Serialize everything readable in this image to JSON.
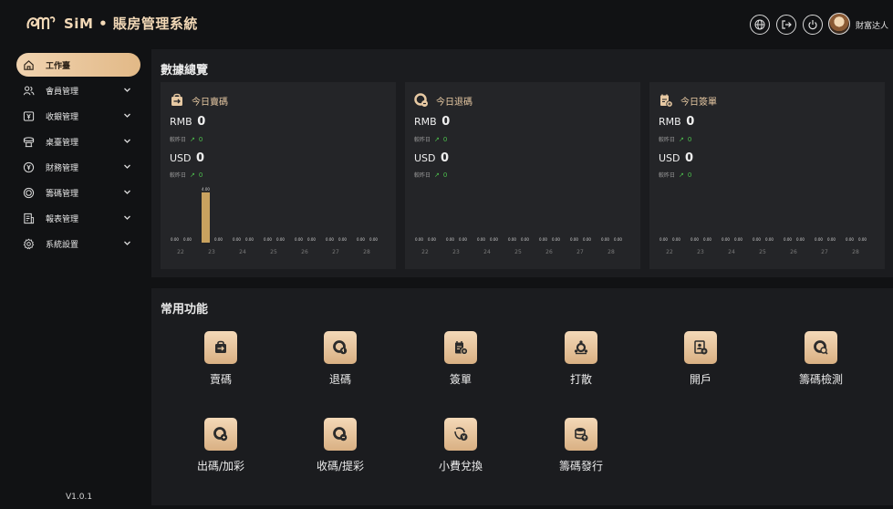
{
  "header": {
    "logo_text": "SiM • 賬房管理系統",
    "username": "財富达人",
    "buttons": [
      "globe-icon",
      "logout-icon",
      "power-icon"
    ]
  },
  "sidebar": {
    "items": [
      {
        "label": "工作臺",
        "icon": "home-icon",
        "active": true
      },
      {
        "label": "會員管理",
        "icon": "users-icon"
      },
      {
        "label": "收銀管理",
        "icon": "cashier-icon"
      },
      {
        "label": "桌臺管理",
        "icon": "table-icon"
      },
      {
        "label": "財務管理",
        "icon": "finance-icon"
      },
      {
        "label": "籌碼管理",
        "icon": "chip-icon"
      },
      {
        "label": "報表管理",
        "icon": "report-icon"
      },
      {
        "label": "系統設置",
        "icon": "settings-icon"
      }
    ],
    "version": "V1.0.1"
  },
  "overview": {
    "title": "數據總覽",
    "compare_label": "較昨日",
    "cards": [
      {
        "title": "今日賣碼",
        "icon": "sell-chip-icon",
        "rmb_label": "RMB",
        "rmb_value": "0",
        "rmb_change": "0",
        "usd_label": "USD",
        "usd_value": "0",
        "usd_change": "0"
      },
      {
        "title": "今日退碼",
        "icon": "return-chip-icon",
        "rmb_label": "RMB",
        "rmb_value": "0",
        "rmb_change": "0",
        "usd_label": "USD",
        "usd_value": "0",
        "usd_change": "0"
      },
      {
        "title": "今日簽單",
        "icon": "sign-bill-icon",
        "rmb_label": "RMB",
        "rmb_value": "0",
        "rmb_change": "0",
        "usd_label": "USD",
        "usd_value": "0",
        "usd_change": "0"
      }
    ]
  },
  "chart_data": [
    {
      "type": "bar",
      "categories": [
        "22",
        "23",
        "24",
        "25",
        "26",
        "27",
        "28"
      ],
      "series": [
        {
          "values": [
            0,
            4.0,
            0,
            0,
            0,
            0,
            0
          ],
          "color": "#c9a25f"
        },
        {
          "values": [
            0,
            0,
            0,
            0,
            0,
            0,
            0
          ],
          "color": "#c9a25f"
        }
      ],
      "ylim": [
        0,
        4.5
      ]
    },
    {
      "type": "bar",
      "categories": [
        "22",
        "23",
        "24",
        "25",
        "26",
        "27",
        "28"
      ],
      "series": [
        {
          "values": [
            0,
            0,
            0,
            0,
            0,
            0,
            0
          ]
        },
        {
          "values": [
            0,
            0,
            0,
            0,
            0,
            0,
            0
          ]
        }
      ]
    },
    {
      "type": "bar",
      "categories": [
        "22",
        "23",
        "24",
        "25",
        "26",
        "27",
        "28"
      ],
      "series": [
        {
          "values": [
            0,
            0,
            0,
            0,
            0,
            0,
            0
          ]
        },
        {
          "values": [
            0,
            0,
            0,
            0,
            0,
            0,
            0
          ]
        }
      ]
    }
  ],
  "functions": {
    "title": "常用功能",
    "items": [
      {
        "label": "賣碼",
        "icon": "sell-icon"
      },
      {
        "label": "退碼",
        "icon": "return-icon"
      },
      {
        "label": "簽單",
        "icon": "sign-icon"
      },
      {
        "label": "打散",
        "icon": "scatter-icon"
      },
      {
        "label": "開戶",
        "icon": "open-account-icon"
      },
      {
        "label": "籌碼檢測",
        "icon": "chip-check-icon"
      },
      {
        "label": "出碼/加彩",
        "icon": "issue-chip-icon"
      },
      {
        "label": "收碼/提彩",
        "icon": "collect-chip-icon"
      },
      {
        "label": "小費兌換",
        "icon": "tip-exchange-icon"
      },
      {
        "label": "籌碼發行",
        "icon": "chip-issue-icon"
      }
    ]
  },
  "colors": {
    "accent": "#e2b987",
    "panel": "#1b1c1f",
    "card": "#242528",
    "up": "#4ec24e"
  }
}
